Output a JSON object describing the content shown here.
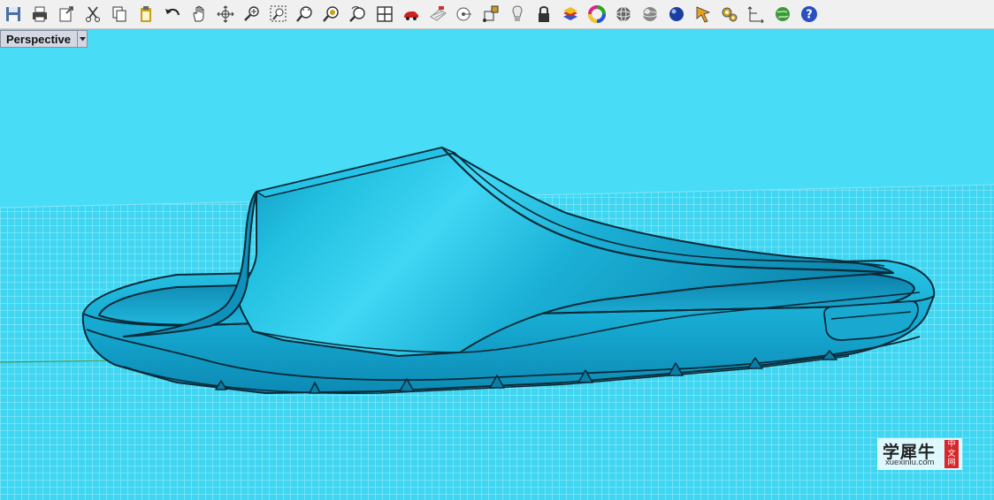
{
  "toolbar": {
    "buttons": [
      {
        "icon": "save-icon",
        "color": "#4a6fa5"
      },
      {
        "icon": "print-icon",
        "color": "#444444"
      },
      {
        "icon": "export-icon",
        "color": "#444444"
      },
      {
        "icon": "cut-icon",
        "color": "#333333"
      },
      {
        "icon": "copy-icon",
        "color": "#333333"
      },
      {
        "icon": "paste-icon",
        "color": "#c8a020"
      },
      {
        "icon": "undo-icon",
        "color": "#222222"
      },
      {
        "icon": "pan-icon",
        "color": "#333333"
      },
      {
        "icon": "rotate-view-icon",
        "color": "#333333"
      },
      {
        "icon": "zoom-dynamic-icon",
        "color": "#333333"
      },
      {
        "icon": "zoom-window-icon",
        "color": "#333333"
      },
      {
        "icon": "zoom-extents-icon",
        "color": "#333333"
      },
      {
        "icon": "zoom-selected-icon",
        "color": "#c8a020"
      },
      {
        "icon": "undo-view-icon",
        "color": "#333333"
      },
      {
        "icon": "four-viewports-icon",
        "color": "#333333"
      },
      {
        "icon": "named-view-icon",
        "color": "#cc2222"
      },
      {
        "icon": "grid-icon",
        "color": "#888888"
      },
      {
        "icon": "point-icon",
        "color": "#555555"
      },
      {
        "icon": "osnap-icon",
        "color": "#c8a020"
      },
      {
        "icon": "light-icon",
        "color": "#aaaaaa"
      },
      {
        "icon": "lock-icon",
        "color": "#333333"
      },
      {
        "icon": "layer-icon",
        "color": "#cc3322"
      },
      {
        "icon": "color-wheel-icon",
        "color": "#dd2288"
      },
      {
        "icon": "wireframe-sphere-icon",
        "color": "#666666"
      },
      {
        "icon": "ghosted-sphere-icon",
        "color": "#888888"
      },
      {
        "icon": "rendered-sphere-icon",
        "color": "#1a3fa0"
      },
      {
        "icon": "material-pointer-icon",
        "color": "#e8a020"
      },
      {
        "icon": "options-gears-icon",
        "color": "#c8a020"
      },
      {
        "icon": "dimension-icon",
        "color": "#333333"
      },
      {
        "icon": "plugin-globe-icon",
        "color": "#3a9a3a"
      },
      {
        "icon": "help-icon",
        "color": "#2a4fc0"
      }
    ]
  },
  "viewport": {
    "title": "Perspective",
    "background_color": "#48dcf6",
    "grid_color": "#a0eefc",
    "model_color": "#1fb2d6"
  },
  "watermark": {
    "chinese_text": "学犀牛",
    "url": "xuexiniu.com",
    "badge_chars": [
      "中",
      "文",
      "网"
    ]
  }
}
